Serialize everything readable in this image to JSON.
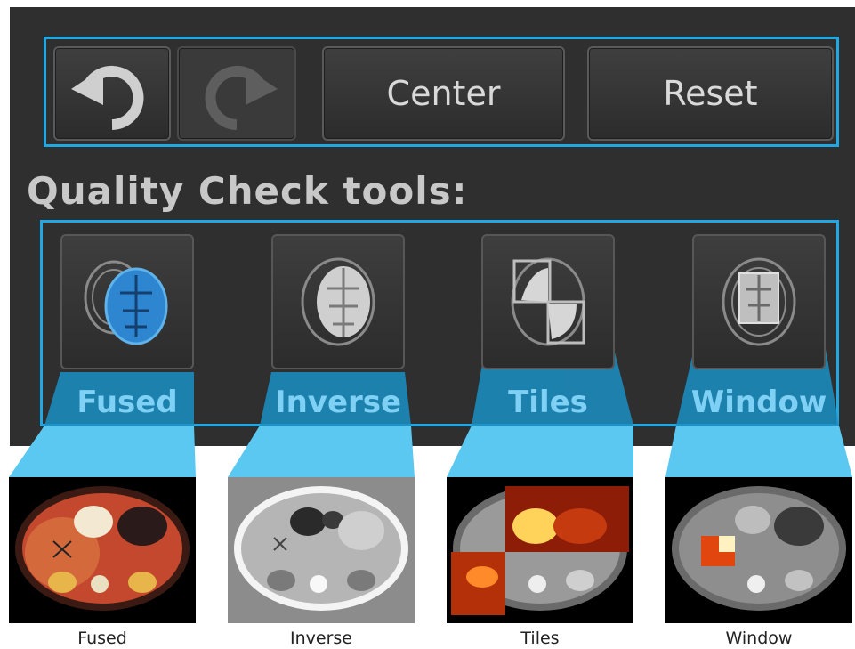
{
  "toolbar": {
    "undo_icon": "undo-icon",
    "redo_icon": "redo-icon",
    "center_label": "Center",
    "reset_label": "Reset"
  },
  "quality_check": {
    "title": "Quality Check tools:",
    "tools": [
      {
        "label": "Fused",
        "icon": "brain-fused-icon"
      },
      {
        "label": "Inverse",
        "icon": "brain-inverse-icon"
      },
      {
        "label": "Tiles",
        "icon": "brain-tiles-icon"
      },
      {
        "label": "Window",
        "icon": "brain-window-icon"
      }
    ]
  },
  "previews": [
    {
      "caption": "Fused"
    },
    {
      "caption": "Inverse"
    },
    {
      "caption": "Tiles"
    },
    {
      "caption": "Window"
    }
  ],
  "colors": {
    "accent": "#21a8e2",
    "panel": "#2f2f2f",
    "label": "#7fd0f5"
  }
}
